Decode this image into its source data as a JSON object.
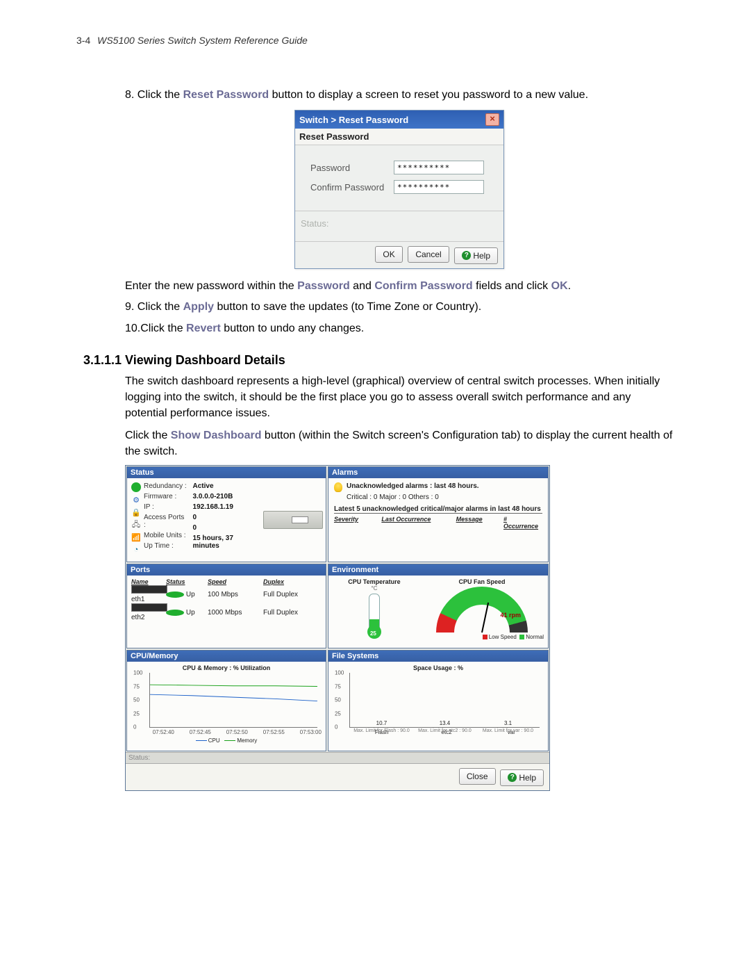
{
  "header": {
    "page_number": "3-4",
    "doc_title": "WS5100 Series Switch System Reference Guide"
  },
  "instructions": {
    "step8_pre": "8. Click the ",
    "step8_action": "Reset Password",
    "step8_post": " button to display a screen to reset you password to a new value.",
    "enter_pre": "Enter the new password within the ",
    "pw": "Password",
    "and": " and ",
    "confirm_pw": "Confirm Password",
    "enter_post": " fields and click ",
    "ok": "OK",
    "period": ".",
    "step9_pre": "9. Click the ",
    "apply": "Apply",
    "step9_post": " button to save the updates (to Time Zone or Country).",
    "step10_pre": "10.Click the ",
    "revert": "Revert",
    "step10_post": " button to undo any changes."
  },
  "section_head": "3.1.1.1 Viewing Dashboard Details",
  "para1": "The switch dashboard represents a high-level (graphical) overview of central switch processes. When initially logging into the switch, it should be the first place you go to assess overall switch performance and any potential performance issues.",
  "para2_pre": "Click the ",
  "show_dashboard": "Show Dashboard",
  "para2_post": " button (within the Switch screen's Configuration tab) to display the current health of the switch.",
  "dialog": {
    "title": "Switch  > Reset Password",
    "section": "Reset Password",
    "password_label": "Password",
    "password_value": "**********",
    "confirm_label": "Confirm Password",
    "confirm_value": "**********",
    "status": "Status:",
    "ok": "OK",
    "cancel": "Cancel",
    "help": "Help"
  },
  "dash": {
    "panels": {
      "status_title": "Status",
      "alarms_title": "Alarms",
      "ports_title": "Ports",
      "env_title": "Environment",
      "cpu_title": "CPU/Memory",
      "fs_title": "File Systems"
    },
    "status": {
      "labels": {
        "redundancy": "Redundancy :",
        "firmware": "Firmware :",
        "ip": "IP :",
        "access_ports": "Access Ports :",
        "mobile_units": "Mobile Units :",
        "uptime": "Up Time :"
      },
      "values": {
        "redundancy": "Active",
        "firmware": "3.0.0.0-210B",
        "ip": "192.168.1.19",
        "access_ports": "0",
        "mobile_units": "0",
        "uptime": "15 hours, 37 minutes"
      }
    },
    "alarms": {
      "headline": "Unacknowledged alarms : last 48 hours.",
      "counts": "Critical :  0    Major :  0    Others :  0",
      "subhead": "Latest 5 unacknowledged critical/major alarms in last 48 hours",
      "cols": {
        "sev": "Severity",
        "last": "Last Occurrence",
        "msg": "Message",
        "occ": "# Occurrence"
      }
    },
    "ports": {
      "cols": {
        "name": "Name",
        "status": "Status",
        "speed": "Speed",
        "duplex": "Duplex"
      },
      "rows": [
        {
          "name": "eth1",
          "status": "Up",
          "speed": "100 Mbps",
          "duplex": "Full Duplex"
        },
        {
          "name": "eth2",
          "status": "Up",
          "speed": "1000 Mbps",
          "duplex": "Full Duplex"
        }
      ]
    },
    "env": {
      "temp_title": "CPU Temperature",
      "temp_unit": "°C",
      "temp_value": "25",
      "fan_title": "CPU Fan Speed",
      "rpm_label": "rpm",
      "rpm_value": "41",
      "legend_low": "Low Speed",
      "legend_normal": "Normal"
    },
    "cpu_chart_title": "CPU & Memory : % Utilization",
    "cpu_legend": {
      "cpu": "CPU",
      "mem": "Memory"
    },
    "fs_chart_title": "Space Usage : %",
    "fs_limits": {
      "flash": "Max. Limit for Flash : 90.0",
      "etc2": "Max. Limit for etc2 : 90.0",
      "var": "Max. Limit for var : 90.0"
    },
    "statusbar": "Status:",
    "close": "Close",
    "help": "Help"
  },
  "chart_data": [
    {
      "type": "line",
      "title": "CPU & Memory : % Utilization",
      "x": [
        "07:52:40",
        "07:52:45",
        "07:52:50",
        "07:52:55",
        "07:53:00"
      ],
      "ylabel": "%",
      "ylim": [
        0,
        100
      ],
      "yticks": [
        0,
        25,
        50,
        75,
        100
      ],
      "series": [
        {
          "name": "CPU",
          "color": "#1e62c9",
          "values": [
            60,
            58,
            55,
            52,
            48
          ]
        },
        {
          "name": "Memory",
          "color": "#1aa11a",
          "values": [
            78,
            77,
            76,
            76,
            75
          ]
        }
      ]
    },
    {
      "type": "bar",
      "title": "Space Usage : %",
      "categories": [
        "Flash",
        "etc2",
        "var"
      ],
      "values": [
        10.7,
        13.4,
        3.1
      ],
      "ylim": [
        0,
        100
      ],
      "yticks": [
        0,
        25,
        50,
        75,
        100
      ],
      "max_limit": 90.0
    },
    {
      "type": "gauge",
      "title": "CPU Fan Speed",
      "value": 41,
      "unit": "rpm",
      "range": [
        0,
        15000
      ],
      "zones": [
        {
          "name": "Low Speed",
          "color": "#d22"
        },
        {
          "name": "Normal",
          "color": "#2cc13c"
        }
      ]
    },
    {
      "type": "gauge",
      "title": "CPU Temperature",
      "value": 25,
      "unit": "°C"
    }
  ]
}
